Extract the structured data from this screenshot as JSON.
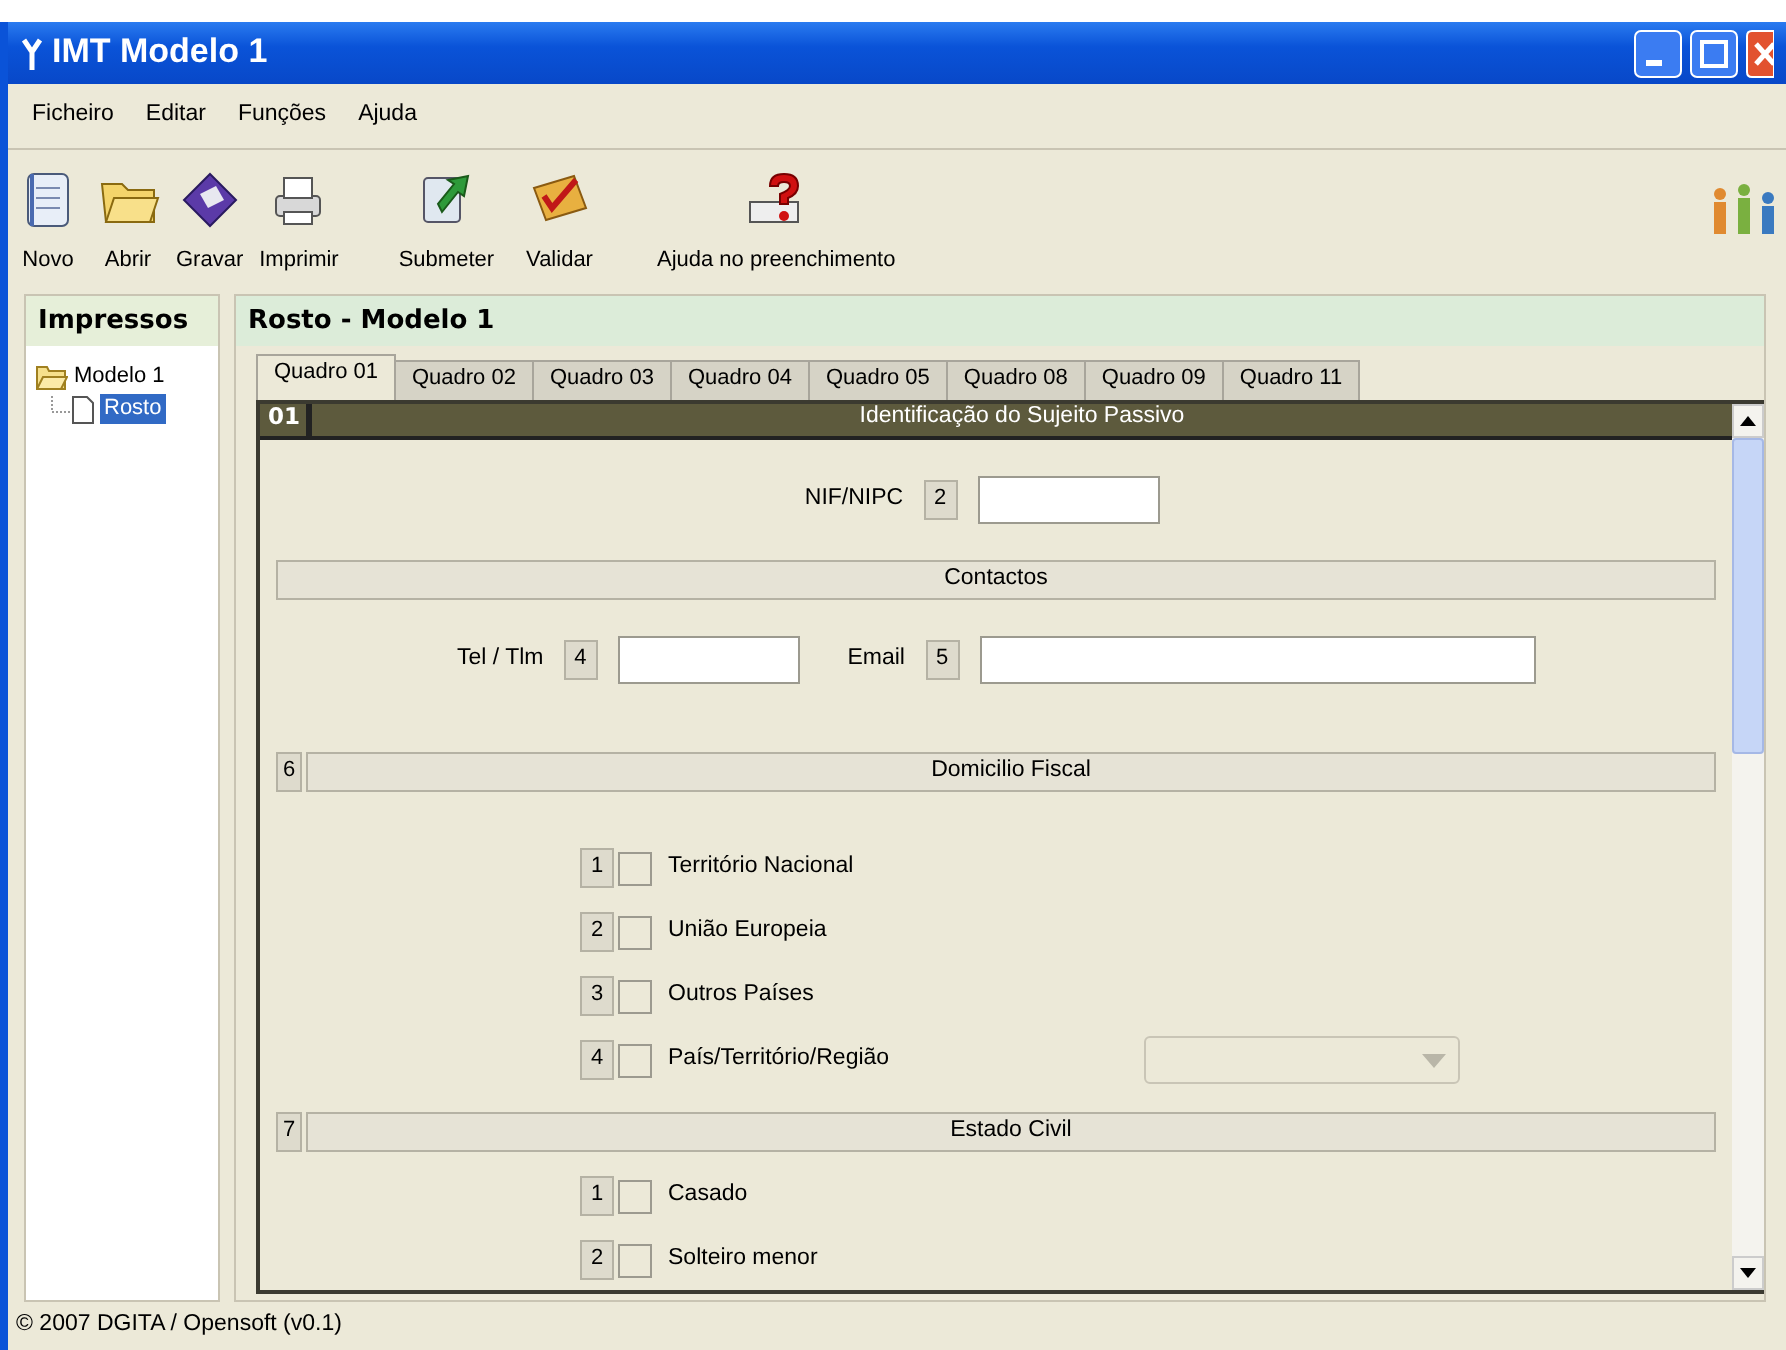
{
  "window": {
    "title": "IMT Modelo 1"
  },
  "menu": [
    "Ficheiro",
    "Editar",
    "Funções",
    "Ajuda"
  ],
  "toolbar": [
    {
      "label": "Novo"
    },
    {
      "label": "Abrir"
    },
    {
      "label": "Gravar"
    },
    {
      "label": "Imprimir"
    },
    {
      "label": "Submeter"
    },
    {
      "label": "Validar"
    },
    {
      "label": "Ajuda no preenchimento"
    }
  ],
  "sidebar": {
    "title": "Impressos",
    "tree": [
      {
        "label": "Modelo 1",
        "expanded": true,
        "selected": false,
        "children": [
          {
            "label": "Rosto",
            "selected": true
          }
        ]
      }
    ]
  },
  "panel": {
    "title": "Rosto - Modelo 1",
    "tabs": [
      {
        "label": "Quadro 01",
        "selected": true
      },
      {
        "label": "Quadro 02",
        "selected": false
      },
      {
        "label": "Quadro 03",
        "selected": false
      },
      {
        "label": "Quadro 04",
        "selected": false
      },
      {
        "label": "Quadro 05",
        "selected": false
      },
      {
        "label": "Quadro 08",
        "selected": false
      },
      {
        "label": "Quadro 09",
        "selected": false
      },
      {
        "label": "Quadro 11",
        "selected": false
      }
    ],
    "section": {
      "number": "01",
      "title": "Identificação do Sujeito Passivo"
    },
    "items": [
      {
        "kind": "fields",
        "fields": [
          {
            "label": "NIF/NIPC",
            "number": "2",
            "kind": "short"
          }
        ]
      },
      {
        "kind": "heading",
        "title": "Contactos"
      },
      {
        "kind": "fields",
        "fields": [
          {
            "label": "Tel / Tlm",
            "number": "4",
            "kind": "short"
          },
          {
            "label": "Email",
            "number": "5",
            "kind": "long"
          }
        ]
      },
      {
        "kind": "heading",
        "number": "6",
        "title": "Domicilio Fiscal"
      },
      {
        "kind": "option",
        "number": "1",
        "label": "Território Nacional",
        "checked": false
      },
      {
        "kind": "option",
        "number": "2",
        "label": "União Europeia",
        "checked": false
      },
      {
        "kind": "option",
        "number": "3",
        "label": "Outros Países",
        "checked": false
      },
      {
        "kind": "option",
        "number": "4",
        "label": "País/Território/Região",
        "checked": false,
        "dropdown": {
          "disabled": true
        }
      },
      {
        "kind": "heading",
        "number": "7",
        "title": "Estado Civil"
      },
      {
        "kind": "option",
        "number": "1",
        "label": "Casado",
        "checked": false
      },
      {
        "kind": "option",
        "number": "2",
        "label": "Solteiro menor",
        "checked": false
      }
    ]
  },
  "status_bar": "© 2007 DGITA / Opensoft (v0.1)"
}
